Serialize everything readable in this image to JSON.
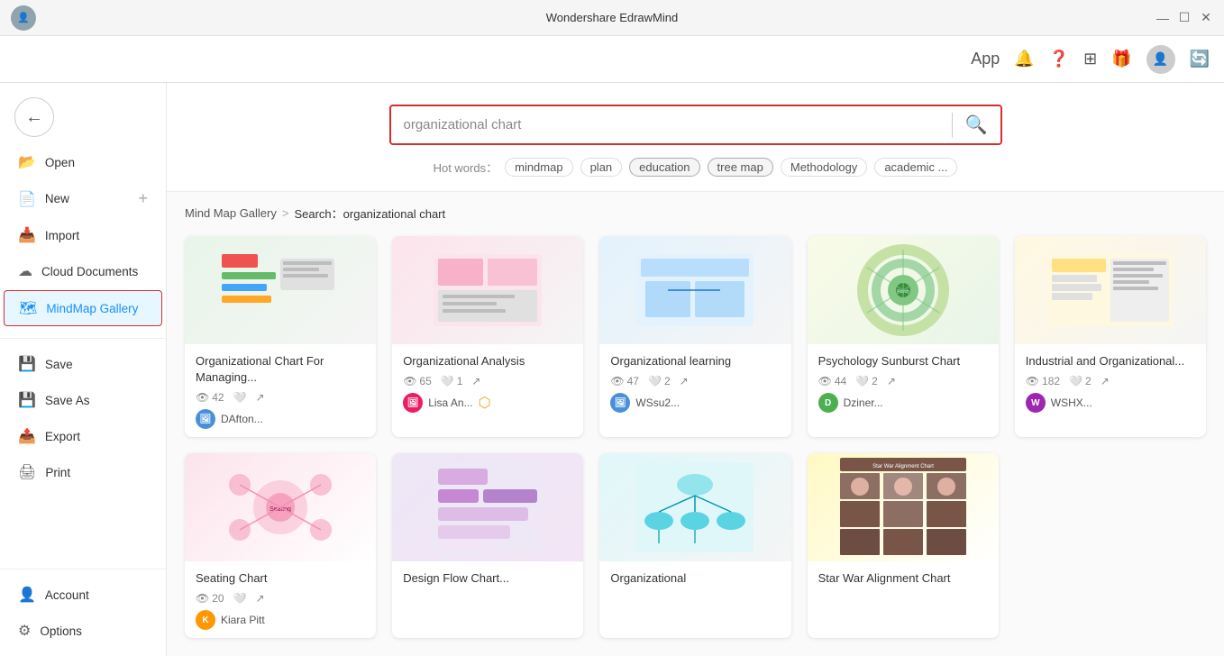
{
  "app": {
    "title": "Wondershare EdrawMind"
  },
  "titlebar": {
    "minimize": "—",
    "maximize": "☐",
    "close": "✕"
  },
  "toolbar": {
    "app_label": "App",
    "icons": [
      "🔔",
      "?",
      "⊞",
      "🎁"
    ]
  },
  "sidebar": {
    "back_icon": "←",
    "items": [
      {
        "id": "open",
        "label": "Open",
        "icon": "📂"
      },
      {
        "id": "new",
        "label": "New",
        "icon": "📄",
        "extra": "+"
      },
      {
        "id": "import",
        "label": "Import",
        "icon": "📥"
      },
      {
        "id": "cloud",
        "label": "Cloud Documents",
        "icon": "☁"
      },
      {
        "id": "mindmap",
        "label": "MindMap Gallery",
        "icon": "🗺",
        "active": true
      }
    ],
    "bottom_items": [
      {
        "id": "save",
        "label": "Save",
        "icon": "💾"
      },
      {
        "id": "saveas",
        "label": "Save As",
        "icon": "💾"
      },
      {
        "id": "export",
        "label": "Export",
        "icon": "📤"
      },
      {
        "id": "print",
        "label": "Print",
        "icon": "🖨"
      }
    ],
    "footer_items": [
      {
        "id": "account",
        "label": "Account",
        "icon": "👤"
      },
      {
        "id": "options",
        "label": "Options",
        "icon": "⚙"
      }
    ]
  },
  "search": {
    "placeholder": "organizational chart",
    "query": "organizational chart",
    "search_icon": "🔍",
    "hot_words_label": "Hot words：",
    "hot_words": [
      "mindmap",
      "plan",
      "education",
      "tree map",
      "Methodology",
      "academic ..."
    ]
  },
  "breadcrumb": {
    "gallery": "Mind Map Gallery",
    "separator": ">",
    "current": "Search：organizational chart"
  },
  "gallery": {
    "cards": [
      {
        "id": "org1",
        "title": "Organizational Chart For Managing...",
        "views": "42",
        "likes": "",
        "likes_count": "",
        "author": "DAfton...",
        "author_color": "#4a90d9",
        "thumb_type": "thumb-org1"
      },
      {
        "id": "org2",
        "title": "Organizational Analysis",
        "views": "65",
        "likes": "1",
        "author": "Lisa An...",
        "author_color": "#e91e63",
        "thumb_type": "thumb-org2",
        "gold_badge": true
      },
      {
        "id": "org3",
        "title": "Organizational learning",
        "views": "47",
        "likes": "2",
        "author": "WSsu2...",
        "author_color": "#4a90d9",
        "thumb_type": "thumb-org3"
      },
      {
        "id": "psych",
        "title": "Psychology Sunburst Chart",
        "views": "44",
        "likes": "2",
        "author": "Dziner...",
        "author_color": "#4CAF50",
        "thumb_type": "thumb-psych",
        "author_initial": "D"
      },
      {
        "id": "ind",
        "title": "Industrial and Organizational...",
        "views": "182",
        "likes": "2",
        "author": "WSHX...",
        "author_color": "#9c27b0",
        "thumb_type": "thumb-ind"
      },
      {
        "id": "seat",
        "title": "Seating Chart",
        "views": "20",
        "likes": "",
        "author": "Kiara Pitt",
        "author_color": "#ff9800",
        "thumb_type": "thumb-seat"
      },
      {
        "id": "flow",
        "title": "Design Flow Chart...",
        "views": "",
        "likes": "",
        "author": "",
        "author_color": "#9c27b0",
        "thumb_type": "thumb-flow"
      },
      {
        "id": "org4",
        "title": "Organizational",
        "views": "",
        "likes": "",
        "author": "",
        "author_color": "#00bcd4",
        "thumb_type": "thumb-org4"
      },
      {
        "id": "star",
        "title": "Star War Alignment Chart",
        "views": "",
        "likes": "",
        "author": "",
        "author_color": "#795548",
        "thumb_type": "thumb-star"
      }
    ]
  }
}
